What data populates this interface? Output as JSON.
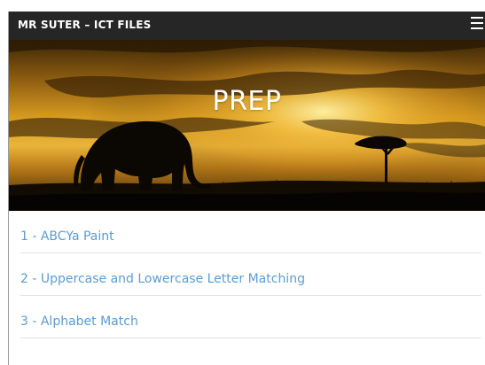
{
  "header": {
    "site_title": "MR SUTER – ICT FILES",
    "menu_icon": "hamburger-menu-icon"
  },
  "hero": {
    "title": "PREP",
    "image": "sunset-savanna-elephant-acacia"
  },
  "links": [
    {
      "label": "1 - ABCYa Paint"
    },
    {
      "label": "2 - Uppercase and Lowercase Letter Matching"
    },
    {
      "label": "3 - Alphabet Match"
    }
  ],
  "colors": {
    "topbar": "#262626",
    "link": "#5b9bd1",
    "divider": "#e3e3e3"
  }
}
